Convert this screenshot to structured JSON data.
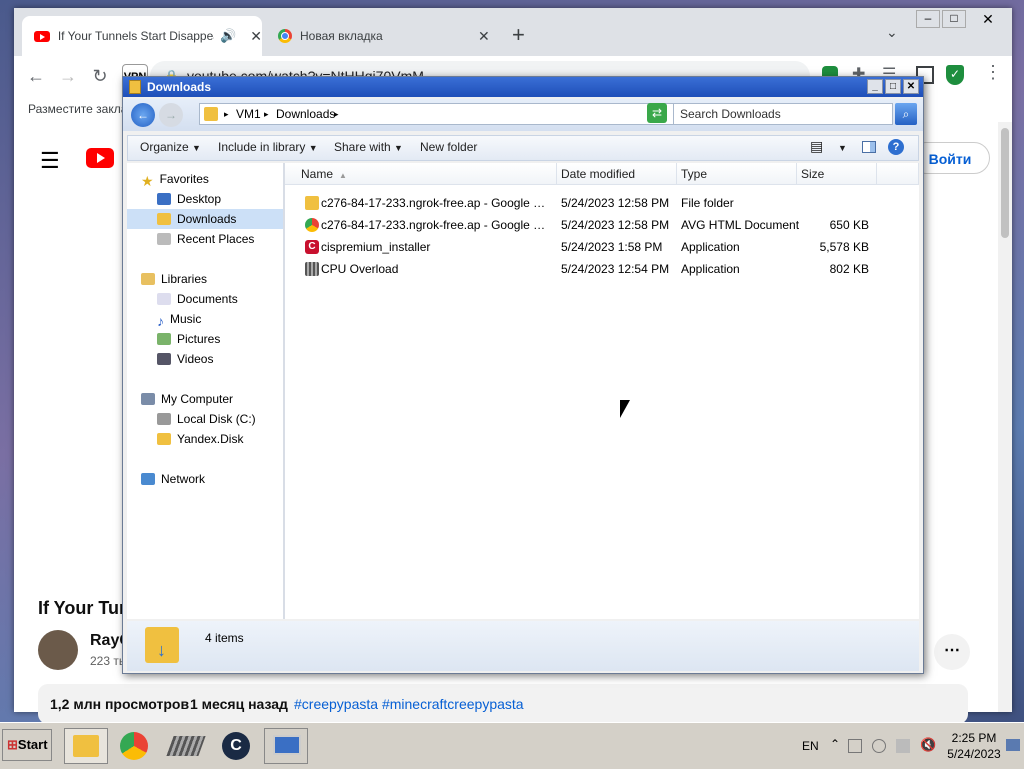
{
  "browser": {
    "tabs": [
      {
        "title": "If Your Tunnels Start Disappear"
      },
      {
        "title": "Новая вкладка"
      }
    ],
    "url": "youtube.com/watch?v=NtHHqi70VmM",
    "bookmarks_hint": "Разместите заклад",
    "vpn_label": "VPN"
  },
  "youtube": {
    "signin_label": "Войти",
    "video_title": "If Your Tunn",
    "channel_name": "RayC",
    "subscribers": "223 ть",
    "meta": {
      "views": "1,2 млн просмотров",
      "age": "1 месяц назад",
      "tags": "#creepypasta #minecraftcreepypasta"
    }
  },
  "explorer": {
    "title": "Downloads",
    "breadcrumb": [
      "VM1",
      "Downloads"
    ],
    "search_placeholder": "Search Downloads",
    "commands": {
      "organize": "Organize",
      "include": "Include in library",
      "share": "Share with",
      "new_folder": "New folder"
    },
    "columns": {
      "name": "Name",
      "date": "Date modified",
      "type": "Type",
      "size": "Size"
    },
    "nav": {
      "favorites": "Favorites",
      "desktop": "Desktop",
      "downloads": "Downloads",
      "recent": "Recent Places",
      "libraries": "Libraries",
      "documents": "Documents",
      "music": "Music",
      "pictures": "Pictures",
      "videos": "Videos",
      "computer": "My Computer",
      "local_disk": "Local Disk (C:)",
      "yandex": "Yandex.Disk",
      "network": "Network"
    },
    "files": [
      {
        "name": "c276-84-17-233.ngrok-free.ap - Google Sear...",
        "date": "5/24/2023 12:58 PM",
        "type": "File folder",
        "size": ""
      },
      {
        "name": "c276-84-17-233.ngrok-free.ap - Google Search",
        "date": "5/24/2023 12:58 PM",
        "type": "AVG HTML Document",
        "size": "650 KB"
      },
      {
        "name": "cispremium_installer",
        "date": "5/24/2023 1:58 PM",
        "type": "Application",
        "size": "5,578 KB"
      },
      {
        "name": "CPU Overload",
        "date": "5/24/2023 12:54 PM",
        "type": "Application",
        "size": "802 KB"
      }
    ],
    "item_count": "4 items"
  },
  "taskbar": {
    "start": "Start",
    "lang": "EN",
    "time": "2:25 PM",
    "date": "5/24/2023"
  },
  "colors": {
    "explorer_title": "#2a5fc8",
    "youtube_red": "#ff0000",
    "selection": "#cce0f7"
  }
}
